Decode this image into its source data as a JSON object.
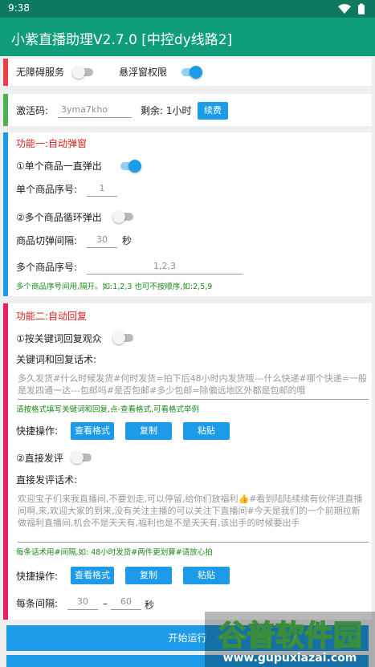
{
  "status": {
    "time": "9:38"
  },
  "app": {
    "title": "小紫直播助理V2.7.0 [中控dy线路2]"
  },
  "perm": {
    "accessibility": "无障碍服务",
    "overlay": "悬浮窗权限"
  },
  "activation": {
    "label": "激活码:",
    "code": "3yma7kho",
    "remaining": "剩余: 1小时",
    "renew": "续费"
  },
  "f1": {
    "title": "功能一:自动弹窗",
    "single_toggle": "①单个商品一直弹出",
    "single_index_label": "单个商品序号:",
    "single_index": "1",
    "multi_toggle": "②多个商品循环弹出",
    "interval_label": "商品切弹间隔:",
    "interval": "30",
    "interval_unit": "秒",
    "multi_index_label": "多个商品序号:",
    "multi_index": "1,2,3",
    "hint": "多个商品序号间用,隔开。如:1,2,3 也可不按顺序,如:2,5,9"
  },
  "f2": {
    "title": "功能二:自动回复",
    "reply_toggle": "①按关键词回复观众",
    "kw_label": "关键词和回复话术:",
    "kw_text": "多久发货#什么时候发货#何时发货=拍下后48小时内发货哦---什么快递#哪个快递=一般是发四通一达---包邮吗#是否包邮#多少包邮=除偏远地区外都是包邮的哦",
    "kw_hint": "请按格式填写关键词和回复,点-查看格式,可看格式举例",
    "quick_label": "快捷操作:",
    "view_btn": "查看格式",
    "copy_btn": "复制",
    "paste_btn": "粘贴",
    "comment_toggle": "②直接发评",
    "comment_label": "直接发评话术:",
    "comment_text": "欢迎宝子们来我直播间,不要划走,可以停留,给你们放福利👍#看到陆陆续续有伙伴进直播间啊,来,欢迎大家的到来,没有关注主播的可以关注下直播间#今天是我们的一个前期拉新做福利直播间,机会不是天天有,福利也是不是天天有,该出手的时候要出手",
    "comment_hint": "每条话术用#间隔,如: 48小时发货#两件更划算#请放心拍",
    "interval_label": "每条间隔:",
    "interval_min": "30",
    "dash": "–",
    "interval_max": "60",
    "unit": "秒"
  },
  "start": {
    "label": "开始运行"
  },
  "watermark": {
    "brand": "谷普软件园",
    "url": "www.gupuxiazai.com"
  },
  "colors": {
    "appbar": "#109e7a",
    "statusbar": "#0d7a5f",
    "accent": "#1e9be8",
    "red_bar": "#e8414c",
    "green_bar": "#4caf50",
    "blue_bar": "#1e9be8",
    "pink_bar": "#e91e63"
  }
}
